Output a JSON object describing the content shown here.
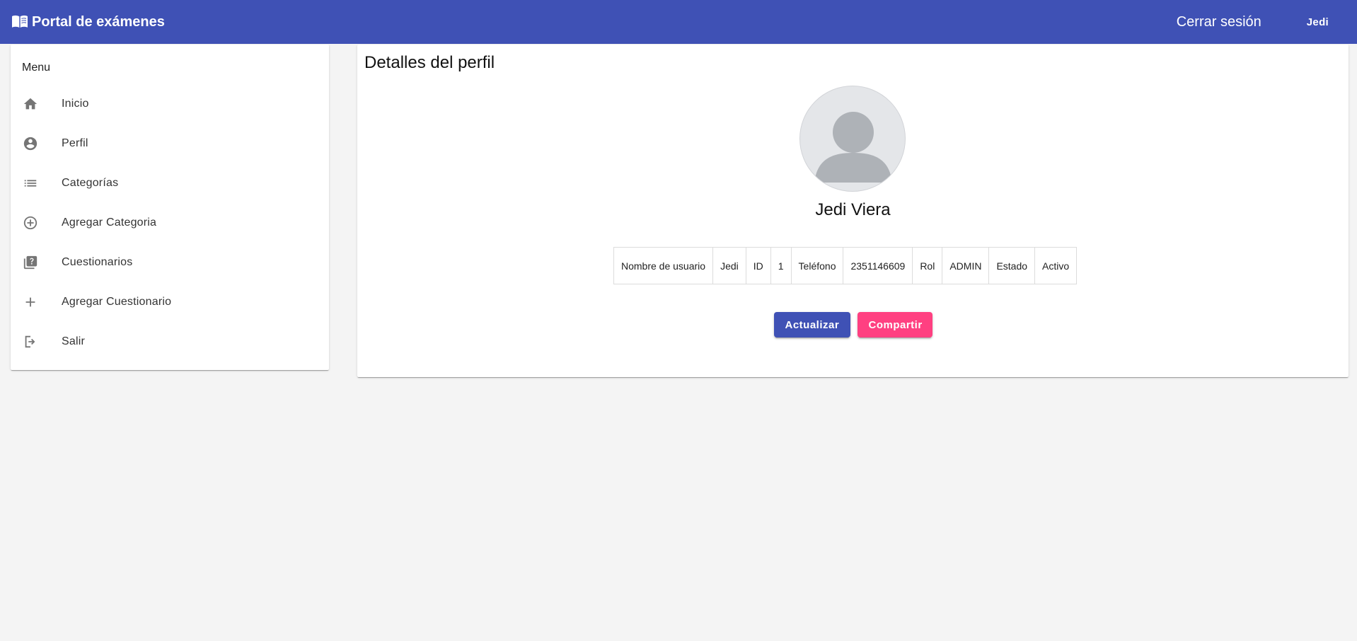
{
  "header": {
    "title": "Portal de exámenes",
    "logout_label": "Cerrar sesión",
    "user_label": "Jedi",
    "color": "#3f51b5"
  },
  "sidebar": {
    "heading": "Menu",
    "items": [
      {
        "label": "Inicio",
        "icon": "home-icon"
      },
      {
        "label": "Perfil",
        "icon": "account-circle-icon"
      },
      {
        "label": "Categorías",
        "icon": "list-icon"
      },
      {
        "label": "Agregar Categoria",
        "icon": "add-circle-outline-icon"
      },
      {
        "label": "Cuestionarios",
        "icon": "quiz-icon"
      },
      {
        "label": "Agregar Cuestionario",
        "icon": "plus-icon"
      },
      {
        "label": "Salir",
        "icon": "logout-icon"
      }
    ]
  },
  "profile": {
    "heading": "Detalles del perfil",
    "name": "Jedi Viera",
    "fields": [
      {
        "label": "Nombre de usuario",
        "value": "Jedi"
      },
      {
        "label": "ID",
        "value": "1"
      },
      {
        "label": "Teléfono",
        "value": "2351146609"
      },
      {
        "label": "Rol",
        "value": "ADMIN"
      },
      {
        "label": "Estado",
        "value": "Activo"
      }
    ],
    "update_label": "Actualizar",
    "share_label": "Compartir",
    "accent_color": "#ff4081"
  }
}
